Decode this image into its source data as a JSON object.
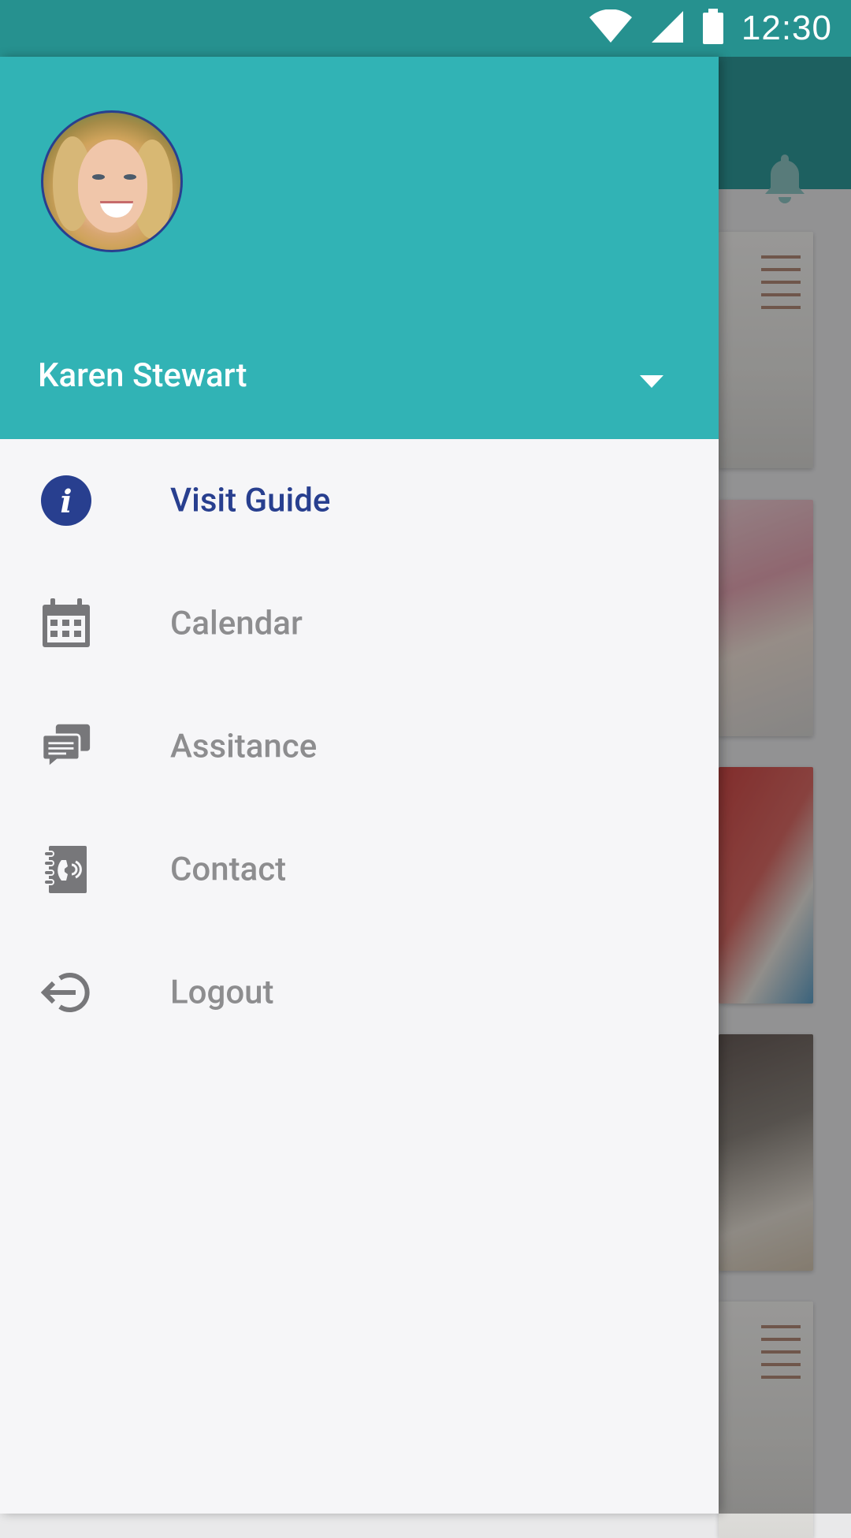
{
  "status_bar": {
    "time": "12:30"
  },
  "colors": {
    "teal_header": "#31b3b5",
    "status_bar": "#26918f",
    "active_blue": "#283f8f",
    "inactive_gray": "#8d8d8f",
    "drawer_bg": "#f6f6f8"
  },
  "drawer": {
    "user_name": "Karen Stewart",
    "items": [
      {
        "label": "Visit Guide",
        "icon": "info-icon",
        "active": true
      },
      {
        "label": "Calendar",
        "icon": "calendar-icon",
        "active": false
      },
      {
        "label": "Assitance",
        "icon": "chat-icon",
        "active": false
      },
      {
        "label": "Contact",
        "icon": "contact-book-icon",
        "active": false
      },
      {
        "label": "Logout",
        "icon": "logout-icon",
        "active": false
      }
    ]
  }
}
